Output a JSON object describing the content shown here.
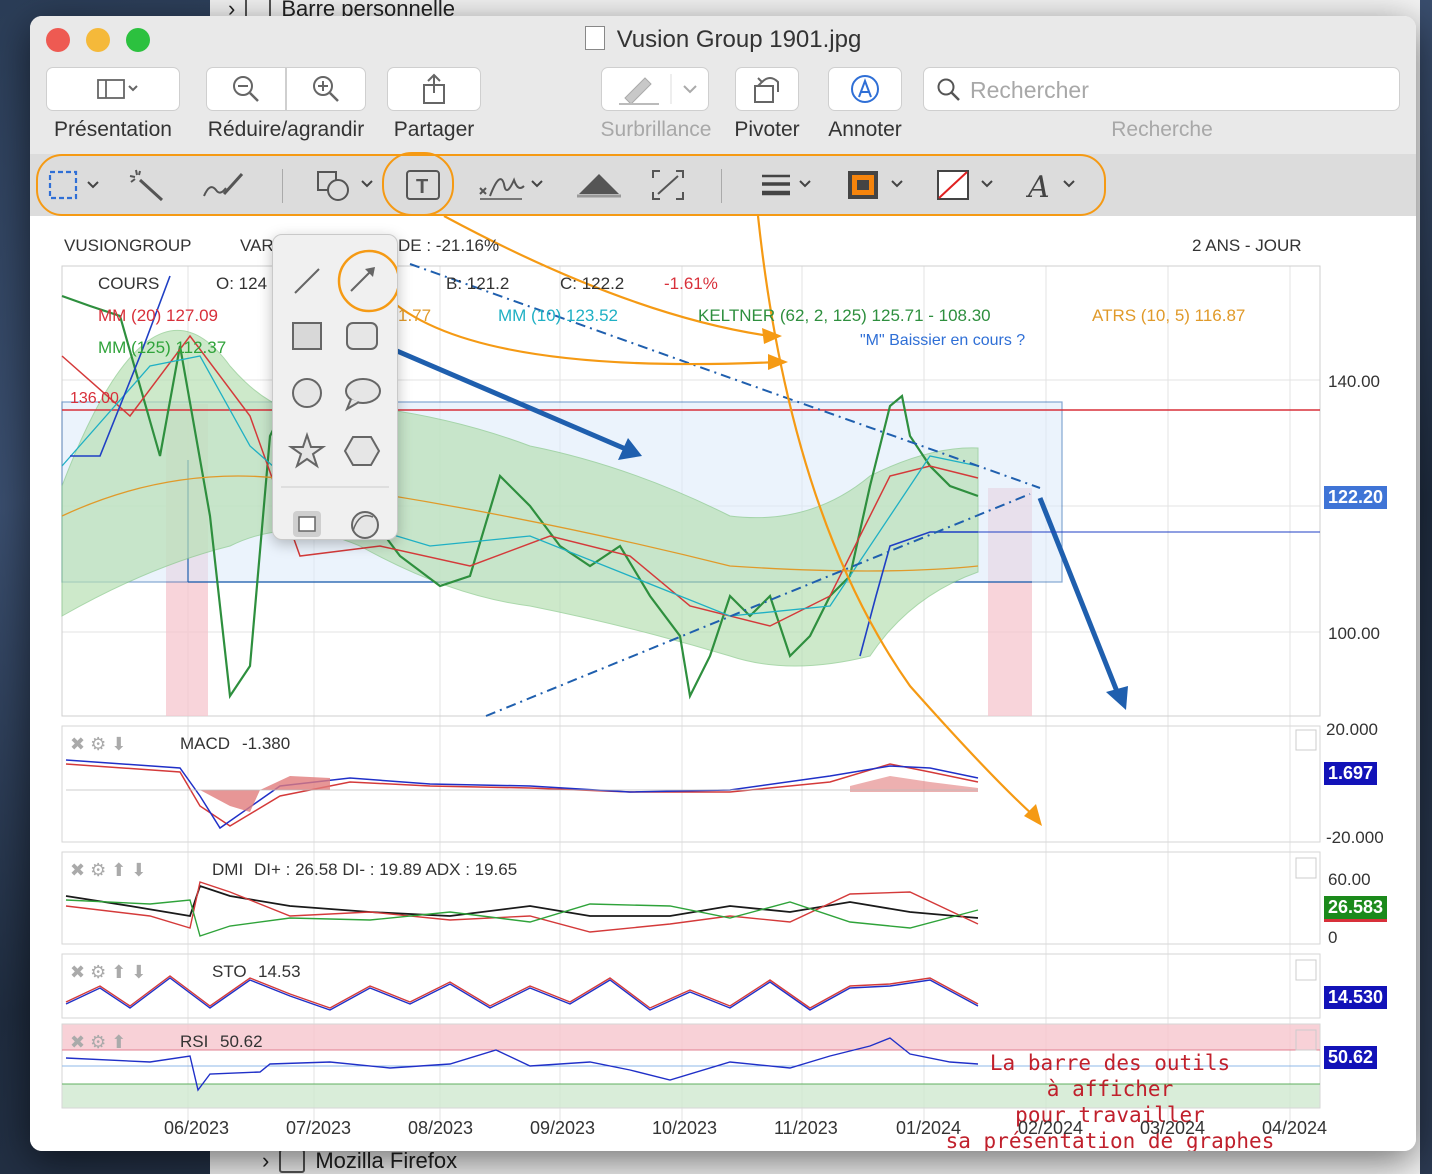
{
  "background_window": {
    "top_item": "Barre personnelle",
    "bottom_item": "Mozilla Firefox"
  },
  "window": {
    "title": "Vusion Group 1901.jpg"
  },
  "toolbar": {
    "presentation": "Présentation",
    "zoom": "Réduire/agrandir",
    "share": "Partager",
    "highlight": "Surbrillance",
    "rotate": "Pivoter",
    "annotate": "Annoter",
    "search_placeholder": "Rechercher",
    "search_label": "Recherche"
  },
  "markup_toolbar": {
    "tools": [
      "rectangular-selection",
      "instant-alpha",
      "sketch",
      "shapes",
      "text",
      "sign",
      "adjust-color",
      "adjust-size",
      "shape-style",
      "border-color",
      "fill-color",
      "text-style"
    ],
    "text_tool_glyph": "T",
    "text_style_glyph": "A"
  },
  "shapes_popover": {
    "items": [
      "line",
      "arrow",
      "rectangle",
      "rounded-rectangle",
      "oval",
      "speech-bubble",
      "star",
      "hexagon",
      "mask",
      "loupe"
    ]
  },
  "chart_header": {
    "ticker": "VUSIONGROUP",
    "var_label": "VAR",
    "var_value": "DE : -21.16%",
    "period": "2 ANS - JOUR",
    "cours": "COURS",
    "open": "O: 124",
    "b": "B: 121.2",
    "c": "C: 122.2",
    "change": "-1.61%",
    "mm20": "MM (20) 127.09",
    "mm_partial": "1.77",
    "mm10": "MM (10) 123.52",
    "keltner": "KELTNER (62, 2, 125)  125.71 - 108.30",
    "atrs": "ATRS (10, 5)  116.87",
    "mm125": "MM (125) 112.37",
    "annotation": "\"M\" Baissier en cours ?",
    "level_136": "136.00"
  },
  "price_axis": {
    "ticks": [
      "140.00",
      "100.00"
    ],
    "last_price": "122.20"
  },
  "indicators": {
    "macd": {
      "label": "MACD",
      "value": "-1.380",
      "axis_top": "20.000",
      "axis_bottom": "-20.000",
      "badge": "1.697"
    },
    "dmi": {
      "label": "DMI",
      "value": "DI+ : 26.58 DI- : 19.89 ADX : 19.65",
      "axis_top": "60.00",
      "axis_bottom": "0",
      "badge": "26.583"
    },
    "sto": {
      "label": "STO",
      "value": "14.53",
      "badge": "14.530"
    },
    "rsi": {
      "label": "RSI",
      "value": "50.62",
      "badge": "50.62"
    }
  },
  "x_axis": [
    "06/2023",
    "07/2023",
    "08/2023",
    "09/2023",
    "10/2023",
    "11/2023",
    "01/2024",
    "02/2024",
    "03/2024",
    "04/2024"
  ],
  "note": {
    "line1": "La barre des outils",
    "line2": "à afficher",
    "line3": "pour travailler",
    "line4": "sa présentation de graphes"
  },
  "colors": {
    "accent_orange": "#f59a14",
    "arrow_blue": "#1f5fae",
    "note_red": "#c0202c",
    "badge_blue": "#1212b8",
    "badge_green": "#1b8a1b",
    "price_badge": "#3f74d6"
  }
}
